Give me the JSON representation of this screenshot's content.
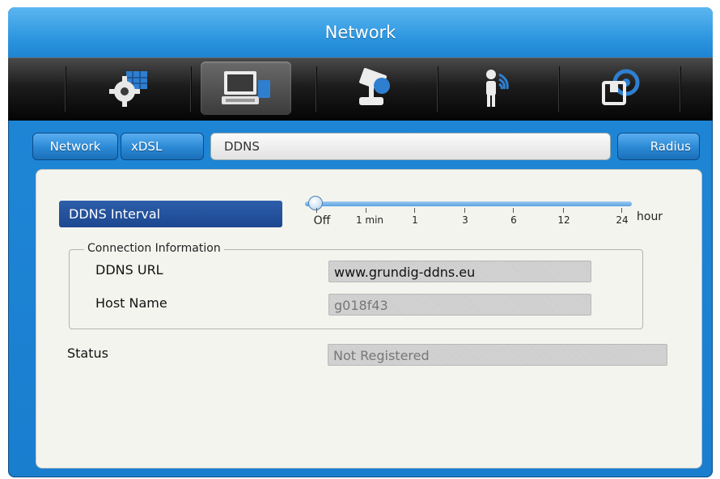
{
  "window": {
    "title": "Network"
  },
  "icon_bar": [
    {
      "icon": "gear-settings-icon",
      "active": false
    },
    {
      "icon": "computer-network-icon",
      "active": true
    },
    {
      "icon": "camera-joystick-icon",
      "active": false
    },
    {
      "icon": "person-wireless-icon",
      "active": false
    },
    {
      "icon": "storage-disc-icon",
      "active": false
    }
  ],
  "tabs": {
    "network": "Network",
    "xdsl": "xDSL",
    "ddns": "DDNS",
    "radius": "Radius"
  },
  "ddns_interval": {
    "label": "DDNS Interval",
    "ticks": [
      "Off",
      "1 min",
      "1",
      "3",
      "6",
      "12",
      "24"
    ],
    "unit": "hour",
    "selected": "Off"
  },
  "connection_info": {
    "legend": "Connection Information",
    "url_label": "DDNS URL",
    "url_value": "www.grundig-ddns.eu",
    "host_label": "Host Name",
    "host_value": "g018f43"
  },
  "status": {
    "label": "Status",
    "value": "Not Registered"
  },
  "colors": {
    "accent_blue": "#1f86d6",
    "label_blue": "#1c4790",
    "icon_bar": "#111111"
  }
}
